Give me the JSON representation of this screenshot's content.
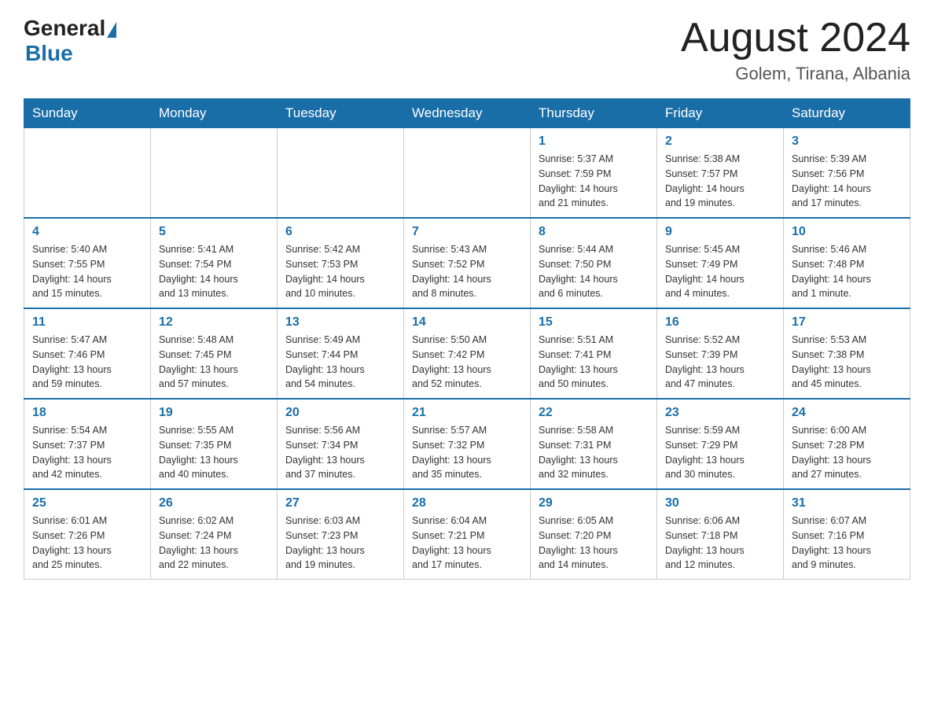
{
  "header": {
    "logo": {
      "general": "General",
      "blue": "Blue"
    },
    "title": "August 2024",
    "location": "Golem, Tirana, Albania"
  },
  "weekdays": [
    "Sunday",
    "Monday",
    "Tuesday",
    "Wednesday",
    "Thursday",
    "Friday",
    "Saturday"
  ],
  "weeks": [
    [
      {
        "day": "",
        "info": ""
      },
      {
        "day": "",
        "info": ""
      },
      {
        "day": "",
        "info": ""
      },
      {
        "day": "",
        "info": ""
      },
      {
        "day": "1",
        "info": "Sunrise: 5:37 AM\nSunset: 7:59 PM\nDaylight: 14 hours\nand 21 minutes."
      },
      {
        "day": "2",
        "info": "Sunrise: 5:38 AM\nSunset: 7:57 PM\nDaylight: 14 hours\nand 19 minutes."
      },
      {
        "day": "3",
        "info": "Sunrise: 5:39 AM\nSunset: 7:56 PM\nDaylight: 14 hours\nand 17 minutes."
      }
    ],
    [
      {
        "day": "4",
        "info": "Sunrise: 5:40 AM\nSunset: 7:55 PM\nDaylight: 14 hours\nand 15 minutes."
      },
      {
        "day": "5",
        "info": "Sunrise: 5:41 AM\nSunset: 7:54 PM\nDaylight: 14 hours\nand 13 minutes."
      },
      {
        "day": "6",
        "info": "Sunrise: 5:42 AM\nSunset: 7:53 PM\nDaylight: 14 hours\nand 10 minutes."
      },
      {
        "day": "7",
        "info": "Sunrise: 5:43 AM\nSunset: 7:52 PM\nDaylight: 14 hours\nand 8 minutes."
      },
      {
        "day": "8",
        "info": "Sunrise: 5:44 AM\nSunset: 7:50 PM\nDaylight: 14 hours\nand 6 minutes."
      },
      {
        "day": "9",
        "info": "Sunrise: 5:45 AM\nSunset: 7:49 PM\nDaylight: 14 hours\nand 4 minutes."
      },
      {
        "day": "10",
        "info": "Sunrise: 5:46 AM\nSunset: 7:48 PM\nDaylight: 14 hours\nand 1 minute."
      }
    ],
    [
      {
        "day": "11",
        "info": "Sunrise: 5:47 AM\nSunset: 7:46 PM\nDaylight: 13 hours\nand 59 minutes."
      },
      {
        "day": "12",
        "info": "Sunrise: 5:48 AM\nSunset: 7:45 PM\nDaylight: 13 hours\nand 57 minutes."
      },
      {
        "day": "13",
        "info": "Sunrise: 5:49 AM\nSunset: 7:44 PM\nDaylight: 13 hours\nand 54 minutes."
      },
      {
        "day": "14",
        "info": "Sunrise: 5:50 AM\nSunset: 7:42 PM\nDaylight: 13 hours\nand 52 minutes."
      },
      {
        "day": "15",
        "info": "Sunrise: 5:51 AM\nSunset: 7:41 PM\nDaylight: 13 hours\nand 50 minutes."
      },
      {
        "day": "16",
        "info": "Sunrise: 5:52 AM\nSunset: 7:39 PM\nDaylight: 13 hours\nand 47 minutes."
      },
      {
        "day": "17",
        "info": "Sunrise: 5:53 AM\nSunset: 7:38 PM\nDaylight: 13 hours\nand 45 minutes."
      }
    ],
    [
      {
        "day": "18",
        "info": "Sunrise: 5:54 AM\nSunset: 7:37 PM\nDaylight: 13 hours\nand 42 minutes."
      },
      {
        "day": "19",
        "info": "Sunrise: 5:55 AM\nSunset: 7:35 PM\nDaylight: 13 hours\nand 40 minutes."
      },
      {
        "day": "20",
        "info": "Sunrise: 5:56 AM\nSunset: 7:34 PM\nDaylight: 13 hours\nand 37 minutes."
      },
      {
        "day": "21",
        "info": "Sunrise: 5:57 AM\nSunset: 7:32 PM\nDaylight: 13 hours\nand 35 minutes."
      },
      {
        "day": "22",
        "info": "Sunrise: 5:58 AM\nSunset: 7:31 PM\nDaylight: 13 hours\nand 32 minutes."
      },
      {
        "day": "23",
        "info": "Sunrise: 5:59 AM\nSunset: 7:29 PM\nDaylight: 13 hours\nand 30 minutes."
      },
      {
        "day": "24",
        "info": "Sunrise: 6:00 AM\nSunset: 7:28 PM\nDaylight: 13 hours\nand 27 minutes."
      }
    ],
    [
      {
        "day": "25",
        "info": "Sunrise: 6:01 AM\nSunset: 7:26 PM\nDaylight: 13 hours\nand 25 minutes."
      },
      {
        "day": "26",
        "info": "Sunrise: 6:02 AM\nSunset: 7:24 PM\nDaylight: 13 hours\nand 22 minutes."
      },
      {
        "day": "27",
        "info": "Sunrise: 6:03 AM\nSunset: 7:23 PM\nDaylight: 13 hours\nand 19 minutes."
      },
      {
        "day": "28",
        "info": "Sunrise: 6:04 AM\nSunset: 7:21 PM\nDaylight: 13 hours\nand 17 minutes."
      },
      {
        "day": "29",
        "info": "Sunrise: 6:05 AM\nSunset: 7:20 PM\nDaylight: 13 hours\nand 14 minutes."
      },
      {
        "day": "30",
        "info": "Sunrise: 6:06 AM\nSunset: 7:18 PM\nDaylight: 13 hours\nand 12 minutes."
      },
      {
        "day": "31",
        "info": "Sunrise: 6:07 AM\nSunset: 7:16 PM\nDaylight: 13 hours\nand 9 minutes."
      }
    ]
  ]
}
